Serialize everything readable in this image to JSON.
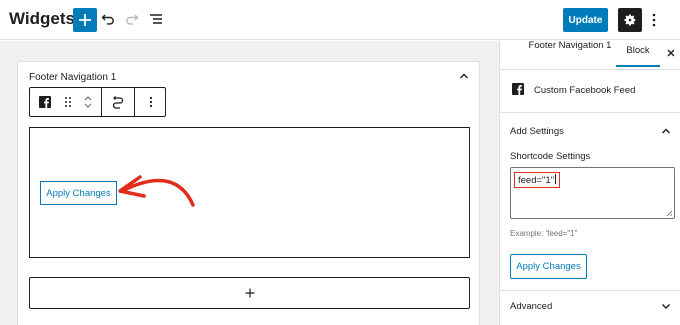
{
  "header": {
    "title": "Widgets",
    "update_label": "Update"
  },
  "widget_area": {
    "title": "Footer Navigation 1",
    "block_button_label": "Apply Changes"
  },
  "sidebar": {
    "tabs": [
      {
        "label": "Footer Navigation 1"
      },
      {
        "label": "Block"
      }
    ],
    "block_title": "Custom Facebook Feed",
    "panel_title": "Add Settings",
    "field_label": "Shortcode Settings",
    "field_value": "feed=\"1\"",
    "help_text": "Example: 'feed=\"1\"",
    "apply_label": "Apply Changes",
    "advanced_label": "Advanced"
  },
  "colors": {
    "accent": "#007cba",
    "annotation": "#e22c1c"
  }
}
